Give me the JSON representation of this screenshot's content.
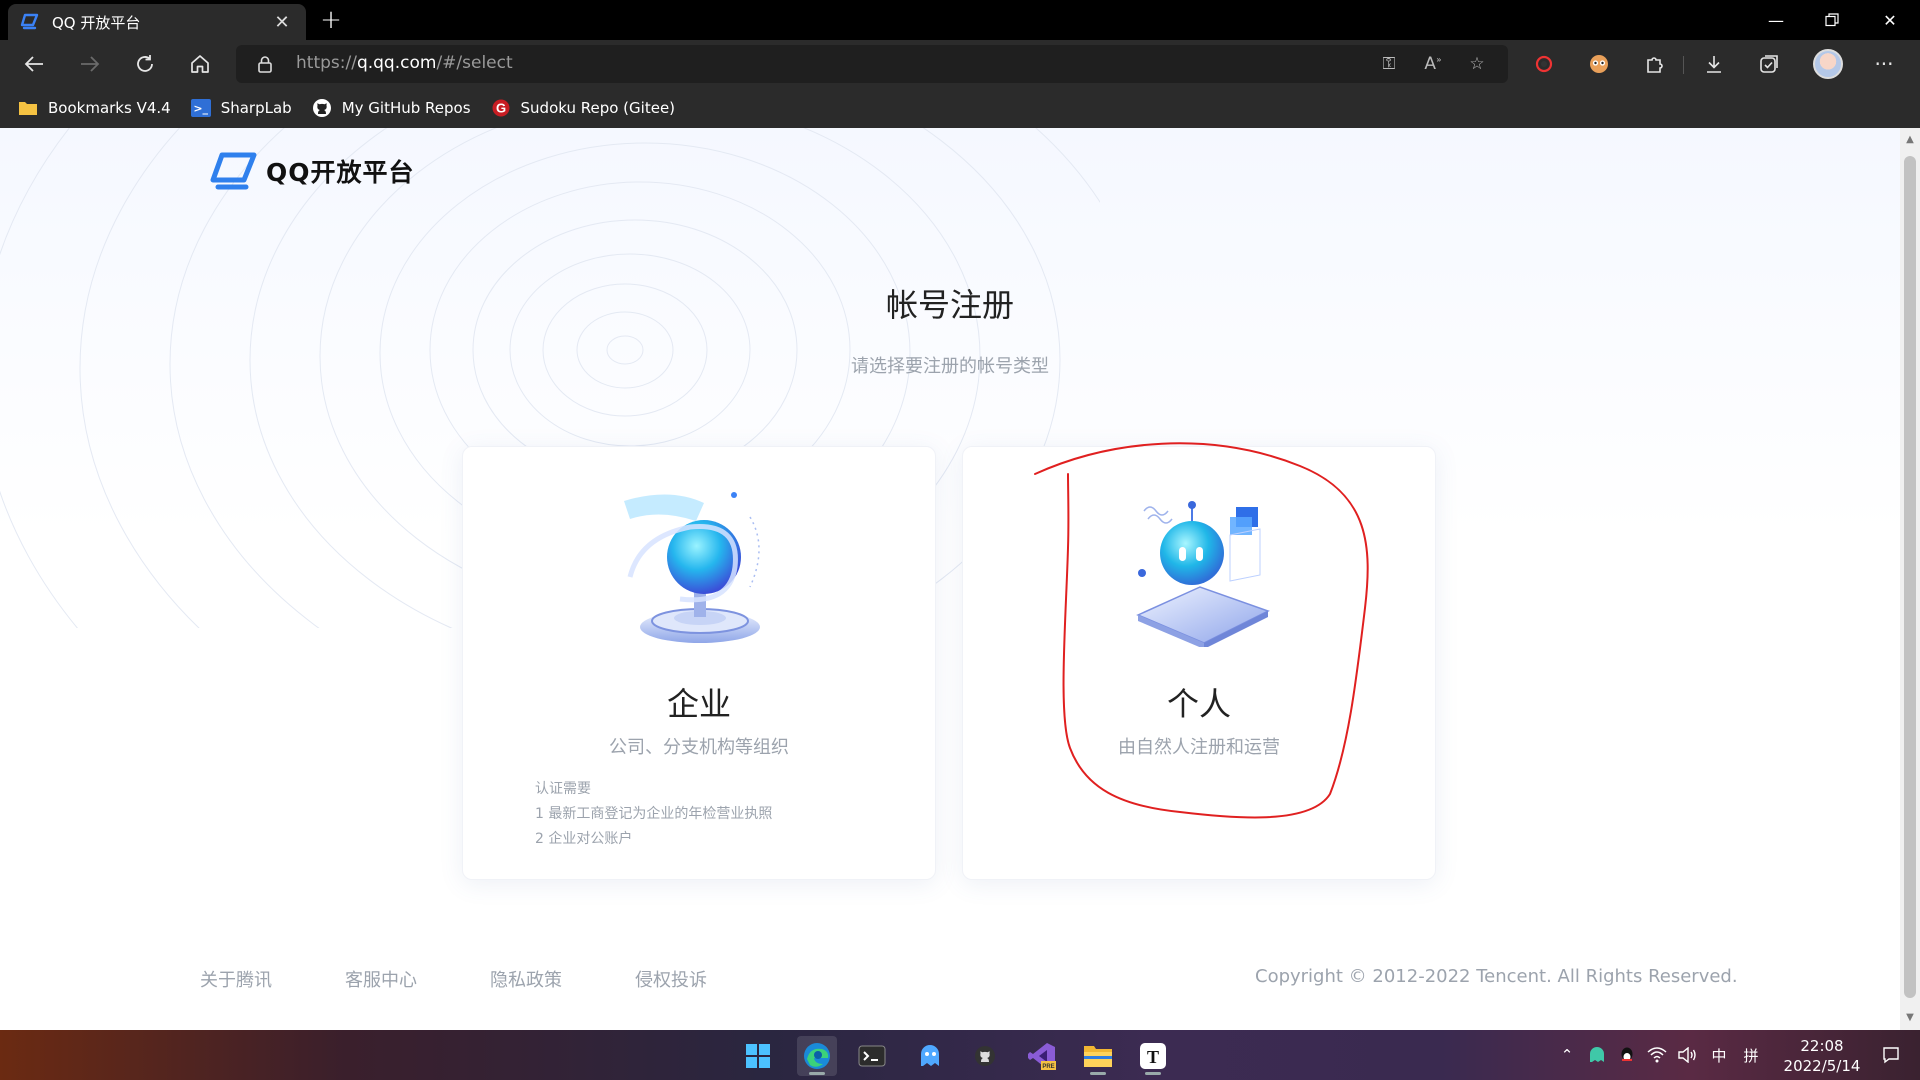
{
  "browser": {
    "tab_title": "QQ 开放平台",
    "new_tab_symbol": "+",
    "url_prefix": "https://",
    "url_host": "q.qq.com",
    "url_path": "/#/select",
    "bookmarks": [
      {
        "label": "Bookmarks V4.4",
        "icon": "folder-icon"
      },
      {
        "label": "SharpLab",
        "icon": "sharplab-icon"
      },
      {
        "label": "My GitHub Repos",
        "icon": "github-icon"
      },
      {
        "label": "Sudoku Repo (Gitee)",
        "icon": "gitee-icon"
      }
    ]
  },
  "page": {
    "logo_text": "QQ开放平台",
    "title": "帐号注册",
    "subtitle": "请选择要注册的帐号类型",
    "cards": [
      {
        "title": "企业",
        "desc": "公司、分支机构等组织",
        "req_title": "认证需要",
        "req_items": [
          "1  最新工商登记为企业的年检营业执照",
          "2  企业对公账户"
        ]
      },
      {
        "title": "个人",
        "desc": "由自然人注册和运营"
      }
    ],
    "annotation_color": "#e02020",
    "footer": {
      "links": [
        "关于腾讯",
        "客服中心",
        "隐私政策",
        "侵权投诉"
      ],
      "copyright": "Copyright © 2012-2022 Tencent. All Rights Reserved."
    }
  },
  "taskbar": {
    "ime": "中",
    "ime_mode": "拼",
    "time": "22:08",
    "date": "2022/5/14"
  }
}
